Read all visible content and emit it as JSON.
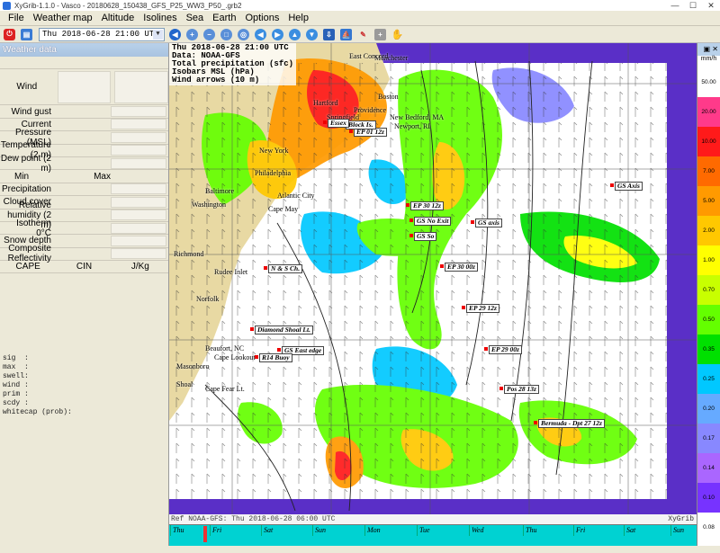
{
  "window": {
    "title": "XyGrib-1.1.0 - Vasco - 20180628_150438_GFS_P25_WW3_P50_.grb2"
  },
  "menu": [
    "File",
    "Weather map",
    "Altitude",
    "Isolines",
    "Sea",
    "Earth",
    "Options",
    "Help"
  ],
  "toolbar": {
    "date_value": "Thu 2018-06-28 21:00 UTC"
  },
  "panel": {
    "title": "Weather data",
    "wind_label": "Wind",
    "rows_a": [
      "Wind gust",
      "Current",
      "Pressure (MSL)",
      "Temperature (2 m)",
      "Dew point (2 m)"
    ],
    "min_label": "Min",
    "max_label": "Max",
    "rows_b": [
      "Precipitation",
      "Cloud cover",
      "Relative humidity (2 m)",
      "Isotherm 0°C",
      "Snow depth",
      "Composite Reflectivity"
    ],
    "cape_label": "CAPE",
    "cin_label": "CIN",
    "jkg_label": "J/Kg",
    "wave_lines": [
      "sig  :",
      "max  :",
      "swell:",
      "wind :",
      "prim :",
      "scdy :",
      "whitecap (prob):"
    ]
  },
  "map": {
    "info": [
      "Thu 2018-06-28 21:00 UTC",
      "Data: NOAA-GFS",
      "Total precipitation (sfc)",
      "Isobars MSL (hPa)",
      "Wind arrows (10 m)"
    ],
    "ref": "Ref NOAA-GFS: Thu 2018-06-28 06:00 UTC",
    "brand": "XyGrib",
    "places": [
      "Manchester",
      "East Concord",
      "Boston",
      "Providence",
      "New Bedford, MA",
      "Newport, RI",
      "Hartford",
      "Springfield",
      "New York",
      "Philadelphia",
      "Atlantic City",
      "Cape May",
      "Washington",
      "Baltimore",
      "Richmond",
      "Norfolk",
      "Rudee Inlet",
      "Beaufort, NC",
      "Cape Lookout",
      "Masonboro",
      "Shoal",
      "Cape Fear Lt."
    ],
    "labels": [
      "EP 01 12z",
      "Block Is.",
      "Essex",
      "GS Axis",
      "EP 30 12z",
      "GS No Exit",
      "GS axis",
      "GS So",
      "EP 30 00z",
      "EP 29 12z",
      "EP 29 00z",
      "Pos 28 13z",
      "Bermuda - Dpt 27 12z",
      "N & S Ch.",
      "Diamond Shoal Lt.",
      "GS East edge",
      "R14 Buoy"
    ]
  },
  "timeline": {
    "days": [
      "Thu",
      "Fri",
      "Sat",
      "Sun",
      "Mon",
      "Tue",
      "Wed",
      "Thu",
      "Fri",
      "Sat",
      "Sun"
    ]
  },
  "scale": {
    "unit": "mm/h",
    "bands": [
      {
        "label": "50.00",
        "color": "#ffffff"
      },
      {
        "label": "20.00",
        "color": "#ff3a8a"
      },
      {
        "label": "10.00",
        "color": "#ff1a1a"
      },
      {
        "label": "7.00",
        "color": "#ff6a00"
      },
      {
        "label": "5.00",
        "color": "#ff9a00"
      },
      {
        "label": "2.00",
        "color": "#ffc800"
      },
      {
        "label": "1.00",
        "color": "#ffff00"
      },
      {
        "label": "0.70",
        "color": "#c8ff00"
      },
      {
        "label": "0.50",
        "color": "#64ff00"
      },
      {
        "label": "0.35",
        "color": "#00e000"
      },
      {
        "label": "0.25",
        "color": "#00c8ff"
      },
      {
        "label": "0.20",
        "color": "#66aaff"
      },
      {
        "label": "0.17",
        "color": "#8888ff"
      },
      {
        "label": "0.14",
        "color": "#aa66ff"
      },
      {
        "label": "0.10",
        "color": "#7733ff"
      },
      {
        "label": "0.08",
        "color": "#ffffff"
      }
    ]
  }
}
